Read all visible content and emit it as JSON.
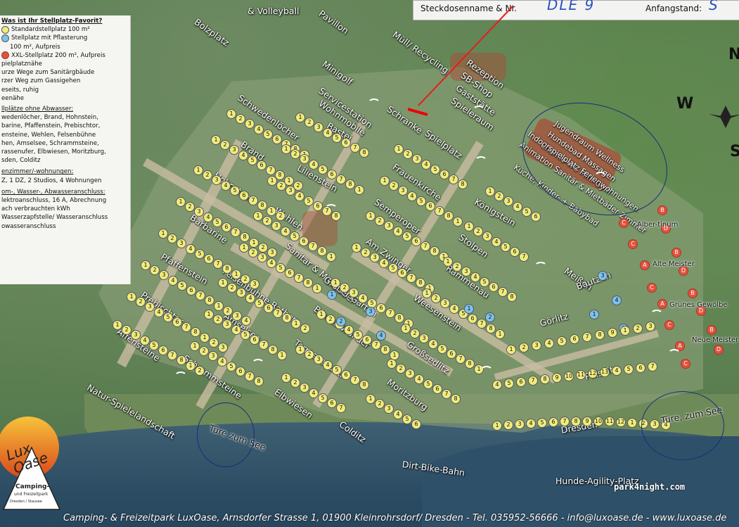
{
  "form": {
    "name_label": "Steckdosenname & Nr.",
    "name_value": "DLE 9",
    "start_label": "Anfangstand:",
    "start_value": "S"
  },
  "legend": {
    "title": "Was ist Ihr Stellplatz-Favorit?",
    "items": [
      "Standardstellplatz 100 m²",
      "Stellplatz mit Pflasterung",
      "100 m², Aufpreis",
      "XXL-Stellplatz 200 m², Aufpreis"
    ],
    "nums": [
      "1",
      "1"
    ],
    "near": [
      "pielplatznähe",
      "urze Wege zum Sanitärgbäude",
      "rzer Weg zum Gassigehen",
      "eseits, ruhig",
      "eenähe"
    ],
    "noww_title": "llplätze ohne Abwasser:",
    "noww": [
      "wedenlöcher, Brand, Hohnstein,",
      "barine, Pfaffenstein, Prebischtor,",
      "ensteine, Wehlen, Felsenbühne",
      "hen, Amselsee, Schrammsteine,",
      "rassenufer, Elbwiesen, Moritzburg,",
      "sden, Colditz"
    ],
    "rooms_title": "enzimmer/-wohnungen:",
    "rooms": "Z, 1 DZ, 2 Studios, 4 Wohnungen",
    "conn_title": "om-, Wasser-, Abwasseranschluss:",
    "conn": [
      "lektroanschluss, 16 A, Abrechnung",
      "ach verbrauchten kWh",
      "Wasserzapfstelle/ Wasseranschluss",
      "owasseranschluss"
    ]
  },
  "areas": {
    "top": [
      "& Volleyball",
      "Pavillon",
      "Bolzplatz",
      "Müll/\nRecycling",
      "Minigolf"
    ],
    "services": [
      "Rezeption",
      "SB-Shop",
      "Gaststätte",
      "Spieleraum"
    ],
    "servicestation": [
      "Servicestation",
      "Wohnmobile"
    ],
    "schranke": "Schranke",
    "spielplatz": "Spielplatz",
    "wellness": [
      "Jugendraum Wellness",
      "Hundebad Massagen",
      "Chemie-WC Mini-Gym",
      "Indoorspielplatz Ferienwohnungen",
      "Animation Sanitär & Mietbäder Zimmer",
      "Küche, Kinder- + Babybad"
    ],
    "fields": [
      "Schwedenlöcher",
      "Bastei",
      "Brand",
      "Liliensteín",
      "Hohnstein",
      "Frauenkirche",
      "Königstein",
      "Wehlen",
      "Semperoper",
      "Barbarine",
      "Sanitär & Mietbäder",
      "Am Zwinger",
      "Stolpen",
      "Pfaffenstein",
      "Felsenbühne Rathen",
      "Rammenau",
      "Meißen",
      "Großer Garten",
      "Prebischtor",
      "Amselsee",
      "Blaues Wunder",
      "Weesenstein",
      "Bautzen",
      "Affensteine",
      "Terrassenufer",
      "Großsedlitz",
      "Görlitz",
      "Schrammsteine",
      "Elbwiesen",
      "Moritzburg",
      "Pulsnitz",
      "Colditz",
      "Dresden"
    ],
    "right": [
      "Alber-tinum",
      "Alte Meister",
      "Grünes Gewölbe",
      "Neue Meister"
    ],
    "bottom": [
      "Natur-Spielelandschaft",
      "Türe zum See",
      "Türe, zum See",
      "Dirt-Bike-Bahn",
      "Hunde-Agility-Platz"
    ],
    "compass": [
      "N",
      "W",
      "S"
    ]
  },
  "logo": {
    "brand": "Lux Oase",
    "sub": "Camping- und Freizeitpark",
    "sub2": "Dresden / Stausee Kleinröhrsdorf"
  },
  "footer": "Camping- & Freizeitpark LuxOase, Arnsdorfer Strasse 1, 01900 Kleinrohrsdorf/ Dresden - Tel. 035952-56666 - info@luxoase.de - www.luxoase.de",
  "watermark": "park4night.com"
}
